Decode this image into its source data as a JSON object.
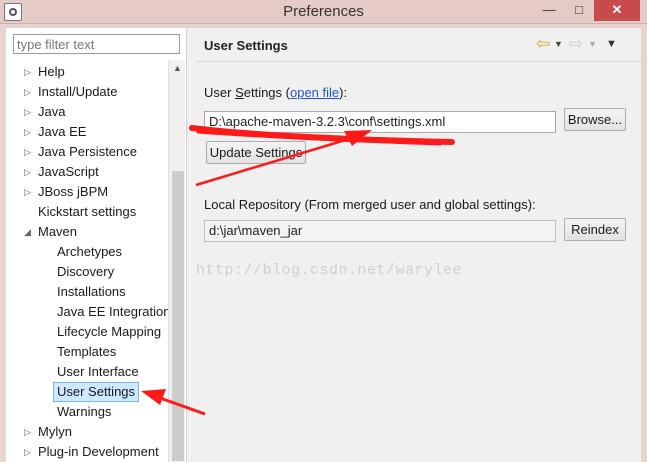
{
  "window": {
    "title": "Preferences",
    "close_glyph": "✕",
    "min_glyph": "—",
    "max_glyph": "□"
  },
  "filter": {
    "placeholder": "type filter text"
  },
  "tree": {
    "items": [
      {
        "label": "Help",
        "level": 0,
        "twisty": "▷"
      },
      {
        "label": "Install/Update",
        "level": 0,
        "twisty": "▷"
      },
      {
        "label": "Java",
        "level": 0,
        "twisty": "▷"
      },
      {
        "label": "Java EE",
        "level": 0,
        "twisty": "▷"
      },
      {
        "label": "Java Persistence",
        "level": 0,
        "twisty": "▷"
      },
      {
        "label": "JavaScript",
        "level": 0,
        "twisty": "▷"
      },
      {
        "label": "JBoss jBPM",
        "level": 0,
        "twisty": "▷"
      },
      {
        "label": "Kickstart settings",
        "level": 0,
        "twisty": ""
      },
      {
        "label": "Maven",
        "level": 0,
        "twisty": "◢"
      },
      {
        "label": "Archetypes",
        "level": 1,
        "twisty": ""
      },
      {
        "label": "Discovery",
        "level": 1,
        "twisty": ""
      },
      {
        "label": "Installations",
        "level": 1,
        "twisty": ""
      },
      {
        "label": "Java EE Integration",
        "level": 1,
        "twisty": ""
      },
      {
        "label": "Lifecycle Mapping",
        "level": 1,
        "twisty": ""
      },
      {
        "label": "Templates",
        "level": 1,
        "twisty": ""
      },
      {
        "label": "User Interface",
        "level": 1,
        "twisty": ""
      },
      {
        "label": "User Settings",
        "level": 1,
        "twisty": "",
        "selected": true
      },
      {
        "label": "Warnings",
        "level": 1,
        "twisty": ""
      },
      {
        "label": "Mylyn",
        "level": 0,
        "twisty": "▷"
      },
      {
        "label": "Plug-in Development",
        "level": 0,
        "twisty": "▷"
      }
    ]
  },
  "page": {
    "title": "User Settings",
    "user_settings_prefix": "User ",
    "user_settings_mnemonic": "S",
    "user_settings_rest": "ettings (",
    "open_file_link": "open file",
    "user_settings_suffix": "):",
    "settings_path": "D:\\apache-maven-3.2.3\\conf\\settings.xml",
    "browse_label": "Browse...",
    "update_label": "Update Settings",
    "local_repo_label": "Local Repository (From merged user and global settings):",
    "repo_path": "d:\\jar\\maven_jar",
    "reindex_label": "Reindex"
  },
  "watermark": "http://blog.csdn.net/warylee",
  "icons": {
    "back": "⇦",
    "forward": "⇨",
    "dropdown": "▼",
    "scroll_up": "▲"
  },
  "colors": {
    "annotation_red": "#ff1a1a",
    "selection_bg": "#cde8ff",
    "link": "#2255cc"
  }
}
